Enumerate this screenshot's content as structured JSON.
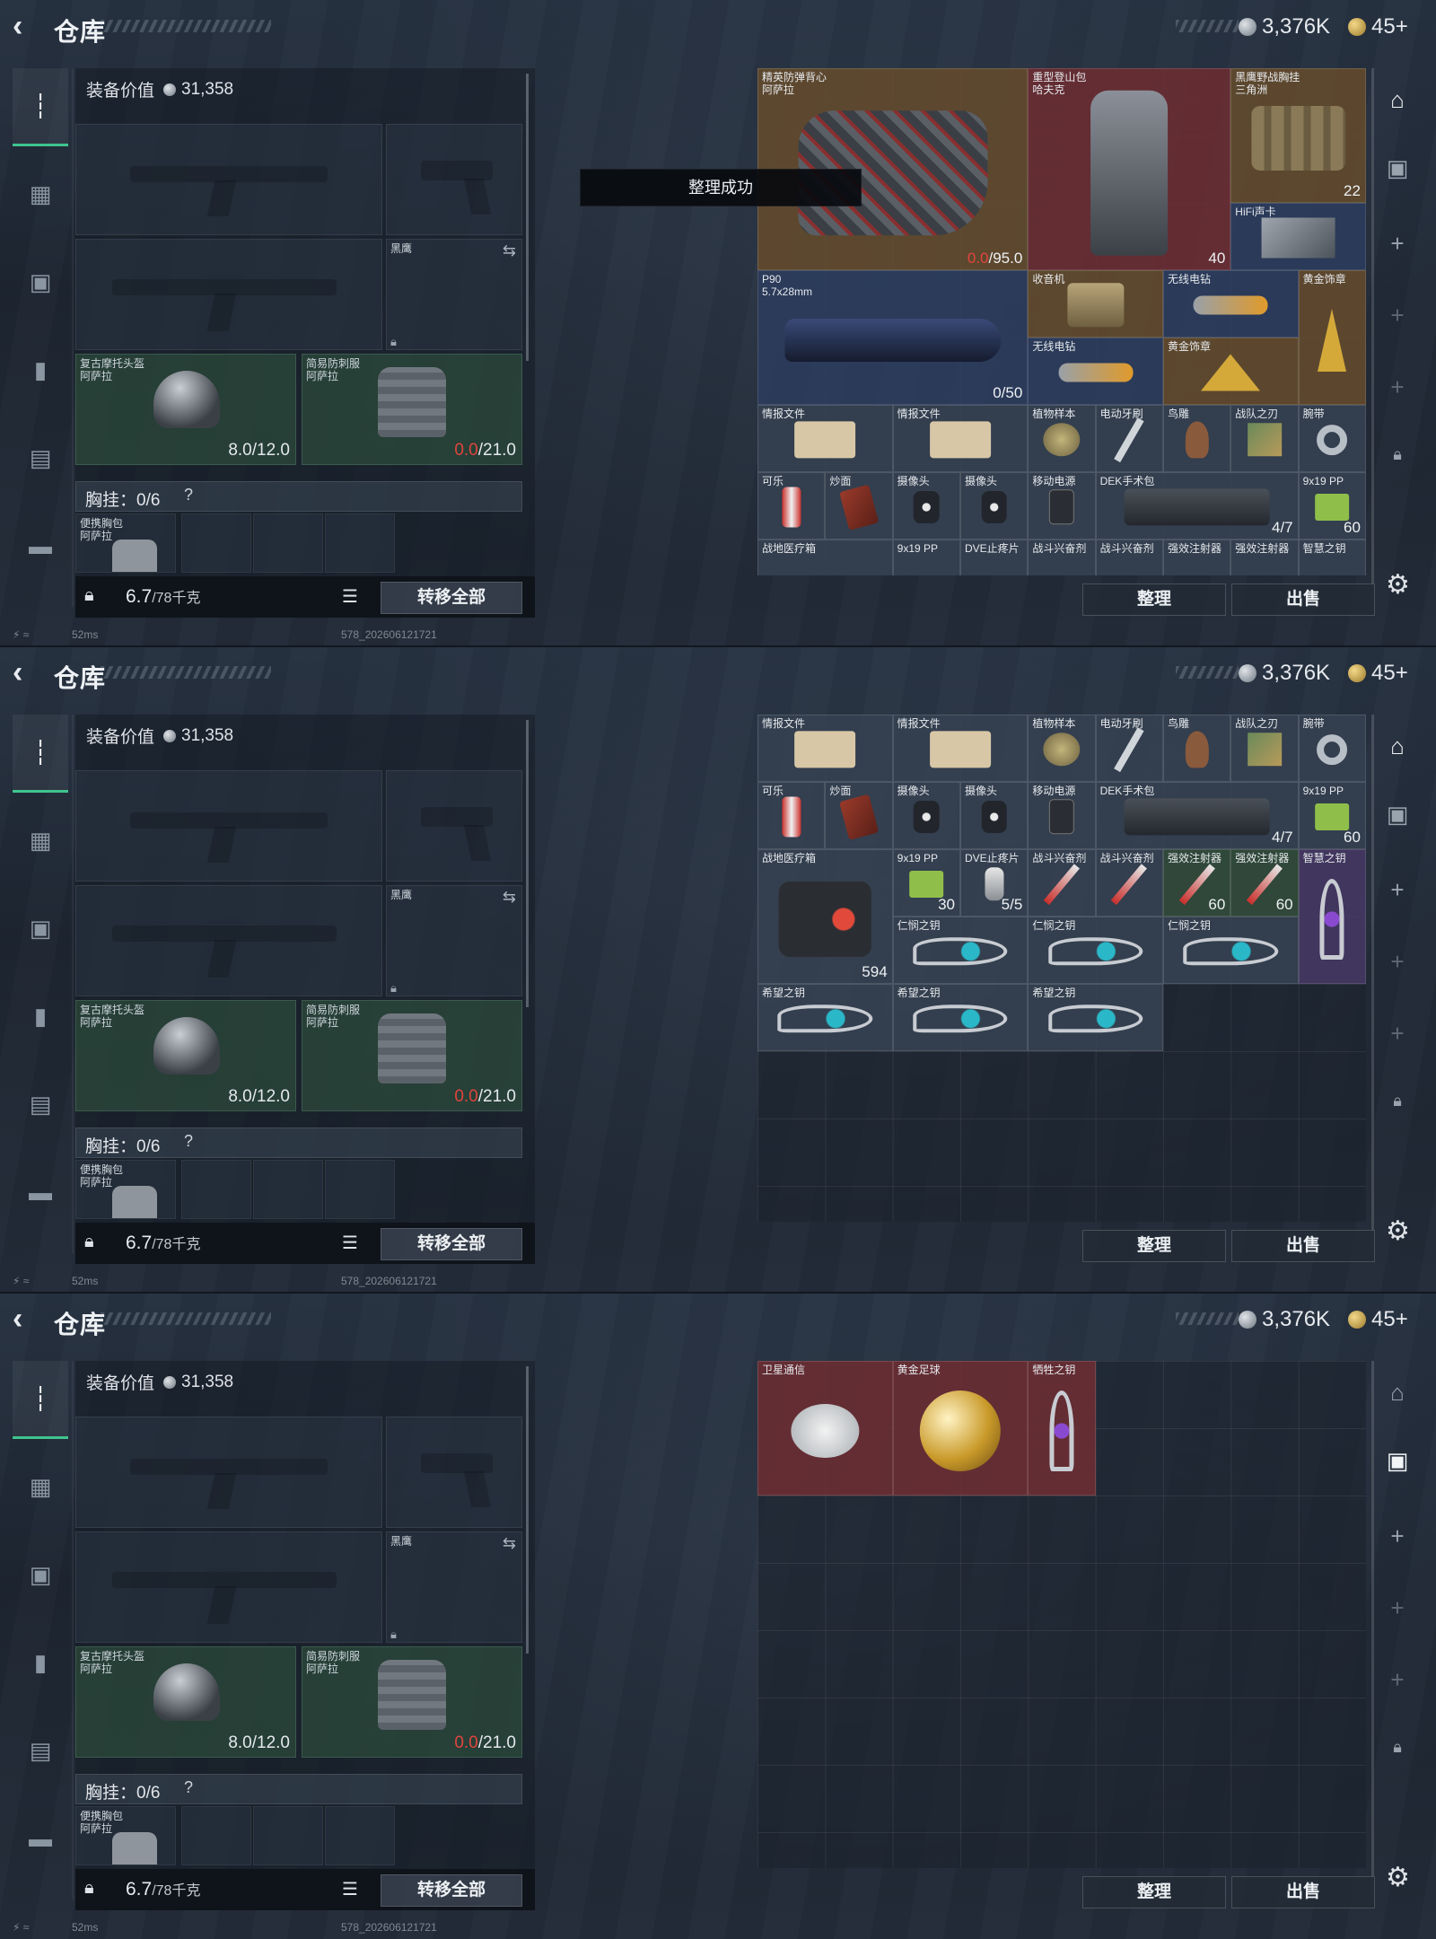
{
  "header": {
    "back_icon": "chevron-left-icon",
    "title": "仓库",
    "silver_amount": "3,376K",
    "gold_amount": "45+"
  },
  "loadout": {
    "equip_value_label": "装备价值",
    "equip_value": "31,358",
    "pistol2_label": "黑鹰",
    "helmet": {
      "name": "复古摩托头盔",
      "sub": "阿萨拉",
      "durability": "8.0/12.0"
    },
    "armor": {
      "name": "简易防刺服",
      "sub": "阿萨拉",
      "durability_current": "0.0",
      "durability_max": "/21.0"
    },
    "chest_rig_label": "胸挂：0/6",
    "chest_help": "?",
    "chest_item": {
      "name": "便携胸包",
      "sub": "阿萨拉"
    },
    "weight": "6.7",
    "weight_unit": "/78千克",
    "transfer_all": "转移全部"
  },
  "actions": {
    "sort": "整理",
    "sell": "出售"
  },
  "footer": {
    "ping": "52ms",
    "version": "578_202606121721"
  },
  "toast": "整理成功",
  "nav_icons": [
    "gun-icon",
    "vest-icon",
    "armor-icon",
    "backpack-icon",
    "pouch-icon",
    "case-icon"
  ],
  "right_icons": [
    "warehouse-icon",
    "camera-iv-icon",
    "plus-icon",
    "plus-icon",
    "plus-icon",
    "lock-icon"
  ],
  "screen1_items": [
    {
      "name": "精英防弹背心",
      "sub": "阿萨拉",
      "value": "0.0",
      "value_max": "/95.0"
    },
    {
      "name": "重型登山包",
      "sub": "哈夫克",
      "value": "40"
    },
    {
      "name": "黑鹰野战胸挂",
      "sub": "三角洲",
      "value": "22"
    },
    {
      "name": "HiFi声卡",
      "sub": ""
    },
    {
      "name": "P90",
      "sub": "5.7x28mm",
      "value": "0/50"
    },
    {
      "name": "收音机"
    },
    {
      "name": "无线电钻"
    },
    {
      "name": "黄金饰章"
    },
    {
      "name": "无线电钻"
    },
    {
      "name": "黄金饰章"
    },
    {
      "name": "情报文件"
    },
    {
      "name": "情报文件"
    },
    {
      "name": "植物样本"
    },
    {
      "name": "电动牙刷"
    },
    {
      "name": "鸟雕"
    },
    {
      "name": "战队之刃"
    },
    {
      "name": "腕带"
    },
    {
      "name": "可乐"
    },
    {
      "name": "炒面"
    },
    {
      "name": "摄像头"
    },
    {
      "name": "摄像头"
    },
    {
      "name": "移动电源"
    },
    {
      "name": "DEK手术包",
      "value": "4/7"
    },
    {
      "name": "9x19 PP",
      "value": "60"
    },
    {
      "name": "战地医疗箱"
    },
    {
      "name": "9x19 PP"
    },
    {
      "name": "DVE止疼片"
    },
    {
      "name": "战斗兴奋剂"
    },
    {
      "name": "战斗兴奋剂"
    },
    {
      "name": "强效注射器"
    },
    {
      "name": "强效注射器"
    },
    {
      "name": "智慧之钥"
    }
  ],
  "screen2_items": [
    {
      "name": "情报文件"
    },
    {
      "name": "情报文件"
    },
    {
      "name": "植物样本"
    },
    {
      "name": "电动牙刷"
    },
    {
      "name": "鸟雕"
    },
    {
      "name": "战队之刃"
    },
    {
      "name": "腕带"
    },
    {
      "name": "可乐"
    },
    {
      "name": "炒面"
    },
    {
      "name": "摄像头"
    },
    {
      "name": "摄像头"
    },
    {
      "name": "移动电源"
    },
    {
      "name": "DEK手术包",
      "value": "4/7"
    },
    {
      "name": "9x19 PP",
      "value": "60"
    },
    {
      "name": "战地医疗箱",
      "value": "594"
    },
    {
      "name": "9x19 PP",
      "value": "30"
    },
    {
      "name": "DVE止疼片",
      "value": "5/5"
    },
    {
      "name": "战斗兴奋剂"
    },
    {
      "name": "战斗兴奋剂"
    },
    {
      "name": "强效注射器",
      "value": "60"
    },
    {
      "name": "强效注射器",
      "value": "60"
    },
    {
      "name": "智慧之钥"
    },
    {
      "name": "仁悯之钥"
    },
    {
      "name": "仁悯之钥"
    },
    {
      "name": "仁悯之钥"
    },
    {
      "name": "希望之钥"
    },
    {
      "name": "希望之钥"
    },
    {
      "name": "希望之钥"
    }
  ],
  "screen3_items": [
    {
      "name": "卫星通信"
    },
    {
      "name": "黄金足球"
    },
    {
      "name": "牺牲之钥"
    }
  ]
}
